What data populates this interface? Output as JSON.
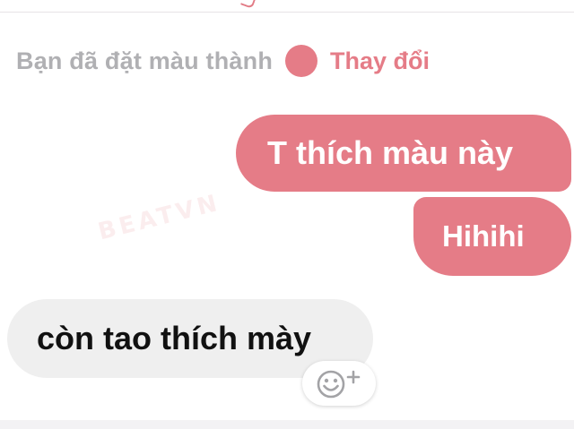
{
  "theme": {
    "accent": "#e57c87",
    "incoming_bg": "#efefef",
    "notice_text_color": "#b0b0b3"
  },
  "system_notice": {
    "text": "Bạn đã đặt màu thành",
    "action_label": "Thay đổi"
  },
  "messages": [
    {
      "direction": "outgoing",
      "text": "T thích màu này"
    },
    {
      "direction": "outgoing",
      "text": "Hihihi"
    },
    {
      "direction": "incoming",
      "text": "còn tao thích mày"
    }
  ],
  "watermark": "BEATVN",
  "reaction": {
    "icon": "add-reaction-icon"
  }
}
